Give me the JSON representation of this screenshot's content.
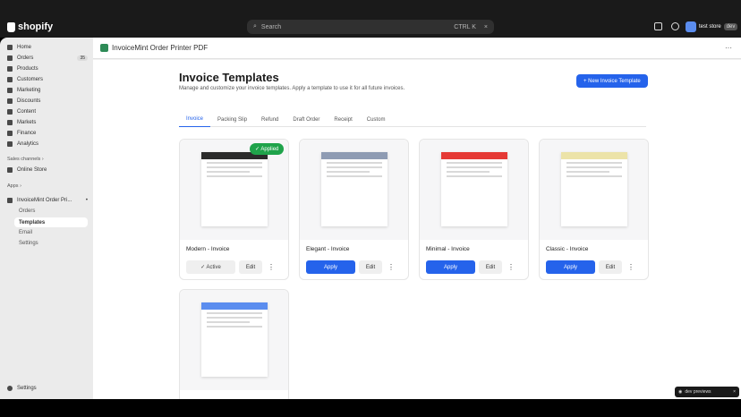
{
  "topbar": {
    "brand": "shopify",
    "search_placeholder": "Search",
    "shortcut": "CTRL K",
    "store_name": "test store",
    "store_badge": "dev"
  },
  "sidebar": {
    "items": [
      {
        "label": "Home",
        "icon": "home-icon"
      },
      {
        "label": "Orders",
        "icon": "orders-icon",
        "badge": "35"
      },
      {
        "label": "Products",
        "icon": "tag-icon"
      },
      {
        "label": "Customers",
        "icon": "person-icon"
      },
      {
        "label": "Marketing",
        "icon": "target-icon"
      },
      {
        "label": "Discounts",
        "icon": "discount-icon"
      },
      {
        "label": "Content",
        "icon": "content-icon"
      },
      {
        "label": "Markets",
        "icon": "globe-icon"
      },
      {
        "label": "Finance",
        "icon": "bank-icon"
      },
      {
        "label": "Analytics",
        "icon": "chart-icon"
      }
    ],
    "sales_channels_label": "Sales channels",
    "online_store": "Online Store",
    "apps_label": "Apps",
    "app_name": "InvoiceMint Order Pri...",
    "app_subitems": [
      "Orders",
      "Templates",
      "Email",
      "Settings"
    ],
    "settings": "Settings"
  },
  "app": {
    "title": "InvoiceMint Order Printer PDF"
  },
  "page": {
    "title": "Invoice Templates",
    "description": "Manage and customize your invoice templates. Apply a template to use it for all future invoices.",
    "new_button": "+ New Invoice Template",
    "tabs": [
      "Invoice",
      "Packing Slip",
      "Refund",
      "Draft Order",
      "Receipt",
      "Custom"
    ]
  },
  "cards": [
    {
      "name": "Modern - Invoice",
      "color": "#2b2b2b",
      "badge": "✓ Applied",
      "primary": "✓ Active",
      "edit": "Edit"
    },
    {
      "name": "Elegant - Invoice",
      "color": "#8e9bb3",
      "primary": "Apply",
      "edit": "Edit"
    },
    {
      "name": "Minimal - Invoice",
      "color": "#e53935",
      "primary": "Apply",
      "edit": "Edit"
    },
    {
      "name": "Classic - Invoice",
      "color": "#ece3a8",
      "primary": "Apply",
      "edit": "Edit"
    },
    {
      "name": "",
      "color": "#5b8def"
    }
  ],
  "devbar": {
    "label": "dev previews"
  }
}
